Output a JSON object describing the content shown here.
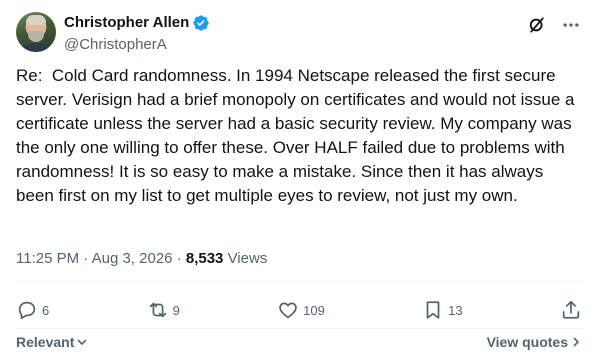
{
  "author": {
    "display_name": "Christopher Allen",
    "handle": "@ChristopherA"
  },
  "header_icons": [
    "grok-icon",
    "more-icon"
  ],
  "post": {
    "text": "Re:  Cold Card randomness. In 1994 Netscape released the first secure server. Verisign had a brief monopoly on certificates and would not issue a certificate unless the server had a basic security review. My company was the only one willing to offer these. Over HALF failed due to problems with randomness! It is so easy to make a mistake. Since then it has always been first on my list to get multiple eyes to review, not just my own."
  },
  "meta": {
    "time": "11:25 PM",
    "separator": "·",
    "date": "Aug 3, 2026",
    "views_count": "8,533",
    "views_label": "Views"
  },
  "actions": {
    "replies": "6",
    "reposts": "9",
    "likes": "109",
    "bookmarks": "13"
  },
  "footer": {
    "sort_label": "Relevant",
    "quotes_label": "View quotes"
  },
  "colors": {
    "text_primary": "#0f1419",
    "text_secondary": "#536471",
    "verified_blue": "#1d9bf0",
    "divider": "#eff3f4"
  }
}
